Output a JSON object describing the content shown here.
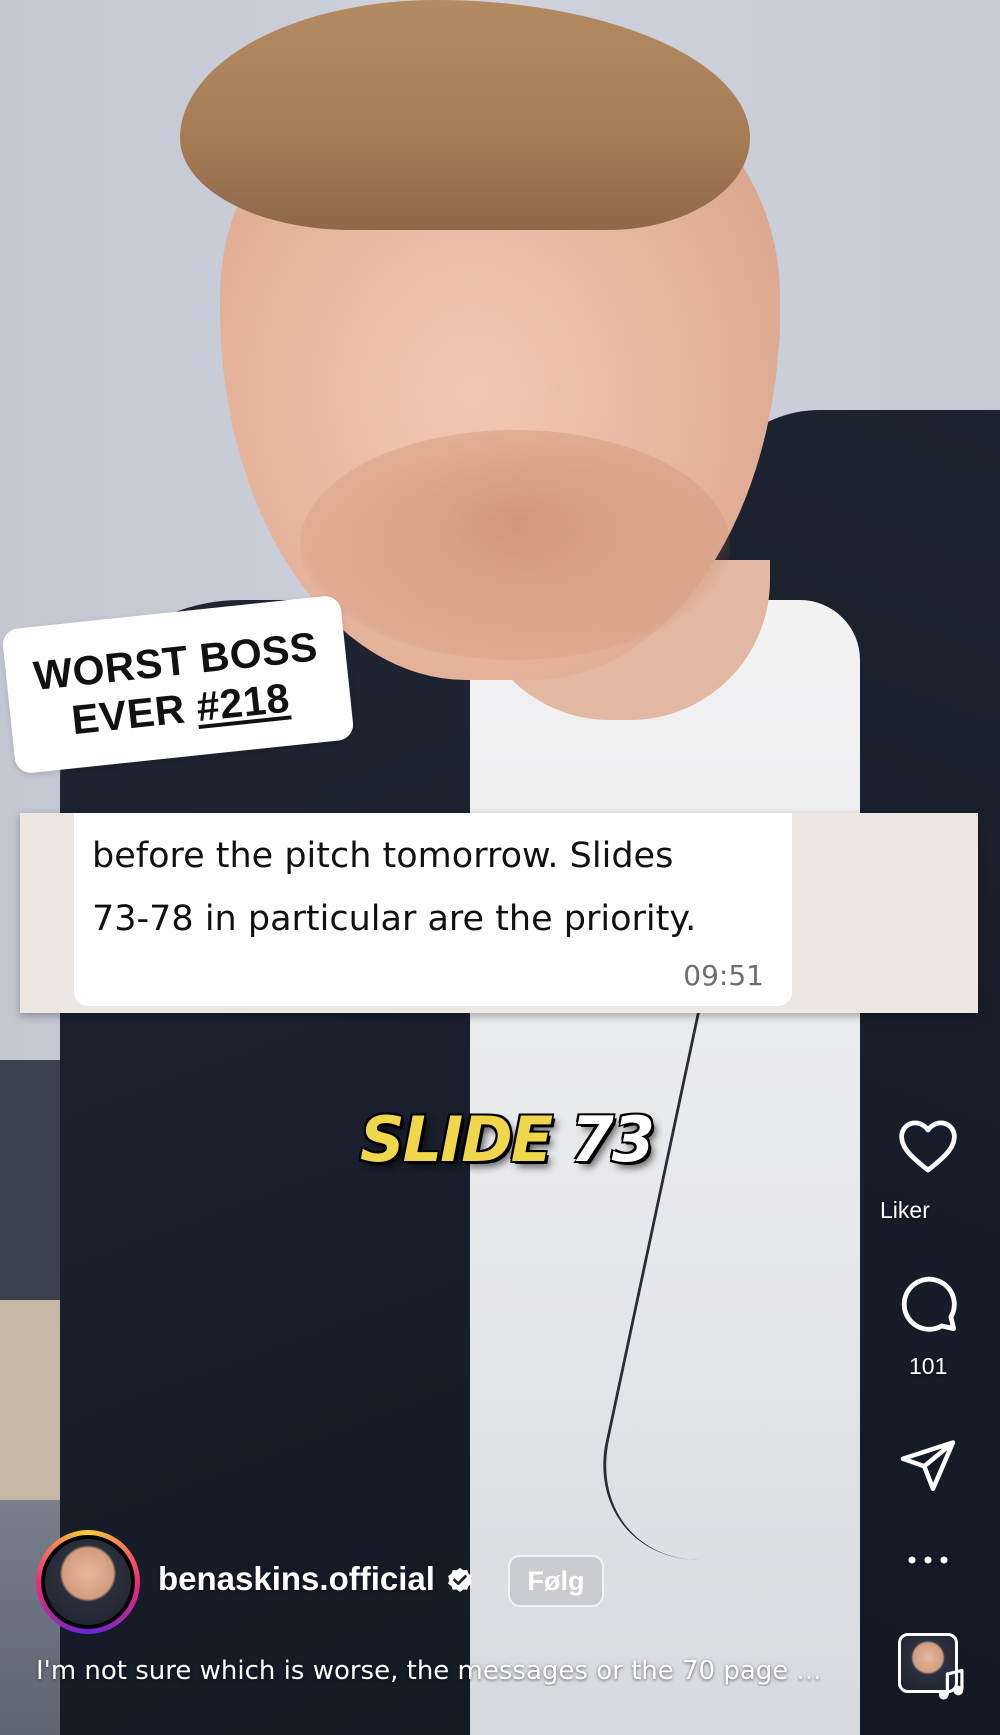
{
  "stickers": {
    "headline_line1": "WORST BOSS",
    "headline_line2_prefix": "EVER ",
    "headline_number": "#218"
  },
  "message": {
    "line1": "before the pitch tomorrow. Slides",
    "line2": "73-78 in particular are the priority.",
    "time": "09:51"
  },
  "overlay_caption": {
    "word1": "SLIDE",
    "word2": "73",
    "word1_color": "#f0d64a",
    "word2_color": "#ffffff"
  },
  "actions": {
    "like_label": "Liker",
    "comment_count": "101",
    "like_icon": "heart-icon",
    "comment_icon": "comment-icon",
    "share_icon": "paper-plane-icon",
    "more_icon": "more-icon"
  },
  "author": {
    "username": "benaskins.official",
    "verified": true,
    "follow_label": "Følg"
  },
  "post": {
    "caption": "I'm not sure which is worse, the messages or the 70 page ..."
  },
  "colors": {
    "avatar_ring": [
      "#f9ce34",
      "#ee2a7b",
      "#6228d7"
    ],
    "slide_yellow": "#f0d64a",
    "message_background": "#ece7e2"
  }
}
